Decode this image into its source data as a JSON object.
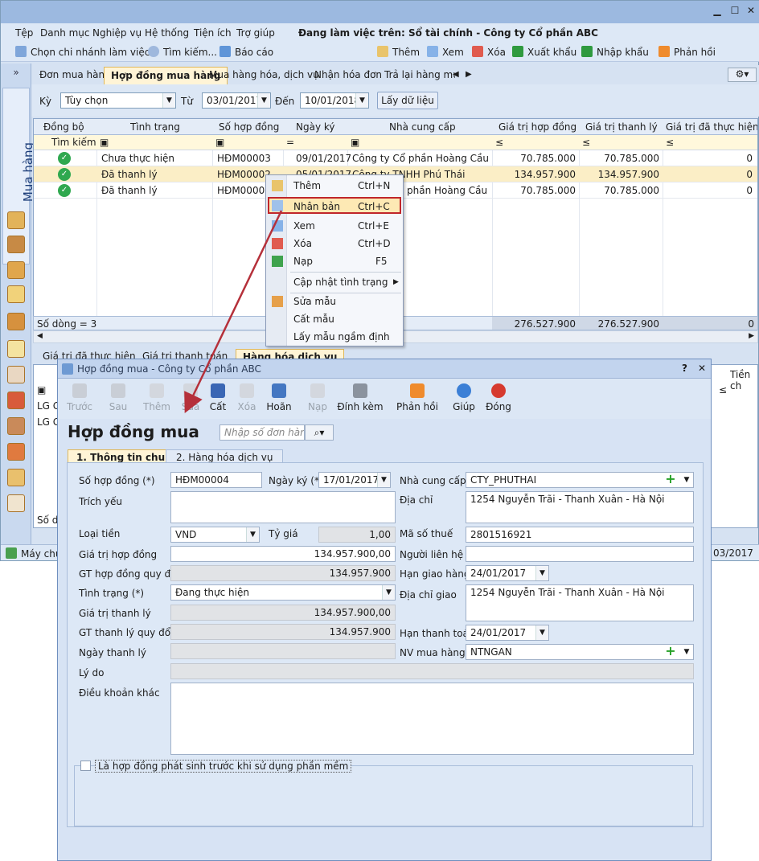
{
  "menu": [
    "Tệp",
    "Danh mục",
    "Nghiệp vụ",
    "Hệ thống",
    "Tiện ích",
    "Trợ giúp"
  ],
  "working_on": "Đang làm việc trên: Sổ tài chính - Công ty Cổ phần ABC",
  "toolbar": {
    "branch": "Chọn chi nhánh làm việc",
    "search": "Tìm kiếm...",
    "report": "Báo cáo",
    "add": "Thêm",
    "view": "Xem",
    "delete": "Xóa",
    "export": "Xuất khẩu",
    "import": "Nhập khẩu",
    "feedback": "Phản hồi"
  },
  "sidebar": {
    "collapse": "»",
    "module": "Mua hàng"
  },
  "tabs": [
    "Đơn mua hàng",
    "Hợp đồng mua hàng",
    "Mua hàng hóa, dịch vụ",
    "Nhận hóa đơn",
    "Trả lại hàng mua"
  ],
  "filter": {
    "period_label": "Kỳ",
    "period_value": "Tùy chọn",
    "from_label": "Từ",
    "from_value": "03/01/2017",
    "to_label": "Đến",
    "to_value": "10/01/2018",
    "get_button": "Lấy dữ liệu"
  },
  "grid": {
    "columns": [
      "Đồng bộ",
      "Tình trạng",
      "Số hợp đồng",
      "Ngày ký",
      "Nhà cung cấp",
      "Giá trị hợp đồng",
      "Giá trị thanh lý",
      "Giá trị đã thực hiện"
    ],
    "search_label": "Tìm kiếm",
    "rows": [
      {
        "status": "Chưa thực hiện",
        "no": "HĐM00003",
        "date": "09/01/2017",
        "supplier": "Công ty Cổ phần Hoàng Cầu",
        "value": "70.785.000",
        "liq": "70.785.000",
        "done": "0"
      },
      {
        "status": "Đã thanh lý",
        "no": "HĐM00002",
        "date": "05/01/2017",
        "supplier": "Công ty TNHH Phú Thái",
        "value": "134.957.900",
        "liq": "134.957.900",
        "done": "0"
      },
      {
        "status": "Đã thanh lý",
        "no": "HĐM00001",
        "date": "",
        "supplier": "phần Hoàng Cầu",
        "value": "70.785.000",
        "liq": "70.785.000",
        "done": "0"
      }
    ],
    "footer_count": "Số dòng = 3",
    "footer_value": "276.527.900",
    "footer_liq": "276.527.900",
    "footer_done": "0"
  },
  "context_menu": [
    {
      "label": "Thêm",
      "shortcut": "Ctrl+N"
    },
    {
      "label": "Nhân bản",
      "shortcut": "Ctrl+C"
    },
    {
      "label": "Xem",
      "shortcut": "Ctrl+E"
    },
    {
      "label": "Xóa",
      "shortcut": "Ctrl+D"
    },
    {
      "label": "Nạp",
      "shortcut": "F5"
    },
    {
      "label": "Cập nhật tình trạng",
      "shortcut": ""
    },
    {
      "label": "Sửa mẫu",
      "shortcut": ""
    },
    {
      "label": "Cất mẫu",
      "shortcut": ""
    },
    {
      "label": "Lấy mẫu ngầm định",
      "shortcut": ""
    }
  ],
  "bottom": {
    "tabs": [
      "Giá trị đã thực hiện",
      "Giá trị thanh toán",
      "Hàng hóa dịch vụ"
    ],
    "rows": [
      "LG G",
      "LG G"
    ],
    "footer": "Số dò",
    "right_col": "Tiền ch",
    "status_left": "Máy chủ:",
    "status_right": "03/2017"
  },
  "dialog": {
    "title": "Hợp đồng mua - Công ty Cổ phần ABC",
    "help": "?",
    "heading": "Hợp đồng mua",
    "search_placeholder": "Nhập số đơn hàng",
    "toolbar": [
      "Trước",
      "Sau",
      "Thêm",
      "Sửa",
      "Cất",
      "Xóa",
      "Hoãn",
      "Nạp",
      "Đính kèm",
      "Phản hồi",
      "Giúp",
      "Đóng"
    ],
    "tab1": "1. Thông tin chung",
    "tab2": "2. Hàng hóa dịch vụ",
    "labels": {
      "contract_no": "Số hợp đồng (*)",
      "sign_date": "Ngày ký (*)",
      "supplier": "Nhà cung cấp",
      "summary": "Trích yếu",
      "address": "Địa chỉ",
      "currency": "Loại tiền",
      "rate": "Tỷ giá",
      "tax": "Mã số thuế",
      "contract_value": "Giá trị hợp đồng",
      "contact": "Người liên hệ",
      "contract_value_conv": "GT hợp đồng quy đổi",
      "delivery_deadline": "Hạn giao hàng",
      "status": "Tình trạng (*)",
      "delivery_address": "Địa chỉ giao",
      "liq_value": "Giá trị thanh lý",
      "liq_value_conv": "GT thanh lý quy đổi",
      "payment_deadline": "Hạn thanh toán",
      "liq_date": "Ngày thanh lý",
      "buyer": "NV mua hàng",
      "reason": "Lý do",
      "other_terms": "Điều khoản khác",
      "pre_software": "Là hợp đồng phát sinh trước khi sử dụng phần mềm"
    },
    "values": {
      "contract_no": "HĐM00004",
      "sign_date": "17/01/2017",
      "supplier": "CTY_PHUTHAI",
      "address": "1254 Nguyễn Trãi - Thanh Xuân - Hà Nội",
      "currency": "VND",
      "rate": "1,00",
      "tax": "2801516921",
      "contract_value": "134.957.900,00",
      "contract_value_conv": "134.957.900",
      "delivery_deadline": "24/01/2017",
      "status": "Đang thực hiện",
      "delivery_address": "1254 Nguyễn Trãi - Thanh Xuân - Hà Nội",
      "liq_value": "134.957.900,00",
      "liq_value_conv": "134.957.900",
      "payment_deadline": "24/01/2017",
      "buyer": "NTNGAN"
    }
  },
  "colors": {
    "highlight_border": "#c0262b",
    "selected_row": "#fbeec6",
    "arrow": "#b5303a"
  }
}
